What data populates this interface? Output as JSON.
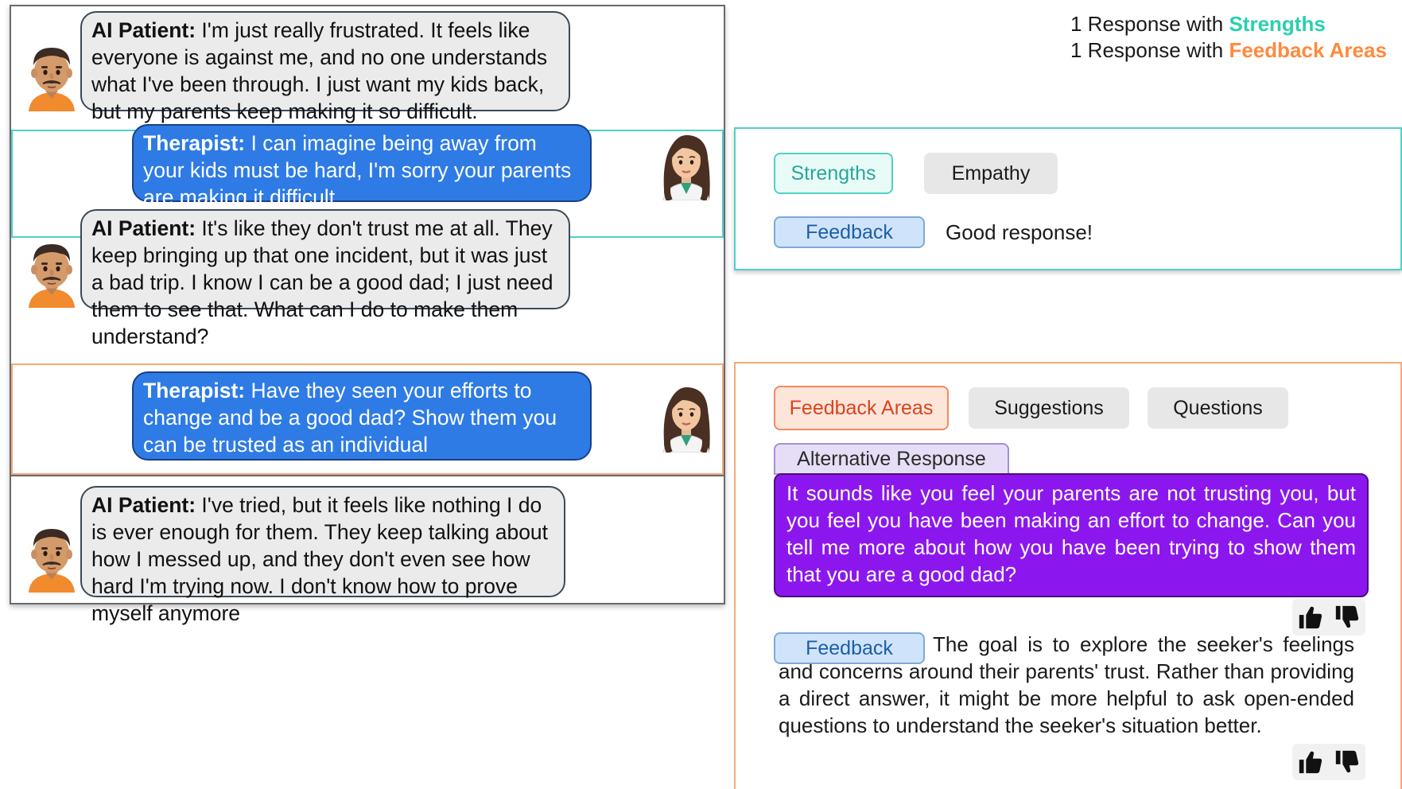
{
  "legend": {
    "line1_prefix": "1 Response with ",
    "line1_highlight": "Strengths",
    "line2_prefix": "1 Response with ",
    "line2_highlight": "Feedback Areas"
  },
  "conversation": [
    {
      "speaker": "AI Patient:",
      "text": " I'm just really frustrated. It feels like everyone is against me, and no one understands what I've been through. I just want my kids back, but my parents keep making it so difficult."
    },
    {
      "speaker": "Therapist:",
      "text": " I can imagine being away from your kids must be hard, I'm sorry your parents are making it difficult."
    },
    {
      "speaker": "AI Patient:",
      "text": " It's like they don't trust me at all. They keep bringing up that one incident, but it was just a bad trip. I know I can be a good dad; I just need them to see that. What can I do to make them understand?"
    },
    {
      "speaker": "Therapist:",
      "text": " Have they seen your efforts to change and be a good dad? Show them you can be trusted as an individual"
    },
    {
      "speaker": "AI Patient:",
      "text": " I've tried, but it feels like nothing I do is ever enough for them. They keep talking about how I messed up, and they don't even see how hard I'm trying now. I don't know how to prove myself anymore"
    }
  ],
  "strengths_panel": {
    "tab_strengths": "Strengths",
    "tab_empathy": "Empathy",
    "feedback_label": "Feedback",
    "feedback_text": "Good response!"
  },
  "feedback_panel": {
    "tab_feedback_areas": "Feedback Areas",
    "tab_suggestions": "Suggestions",
    "tab_questions": "Questions",
    "alt_label": "Alternative Response",
    "alt_text": "It sounds like you feel your parents are not trusting you, but you feel you have been making an effort to change. Can you tell me more about how you have been trying to show them that you are a good dad?",
    "feedback_label": "Feedback",
    "feedback_text": "The goal is to explore the seeker's feelings and concerns around their parents' trust. Rather than providing a direct answer, it might be more helpful to ask open-ended questions to understand the seeker's situation better."
  },
  "colors": {
    "strengths": "#2ad0ad",
    "feedback_areas": "#ff8a3d",
    "therapist_bubble": "#2e7be6",
    "alt_response": "#8c17ee"
  }
}
